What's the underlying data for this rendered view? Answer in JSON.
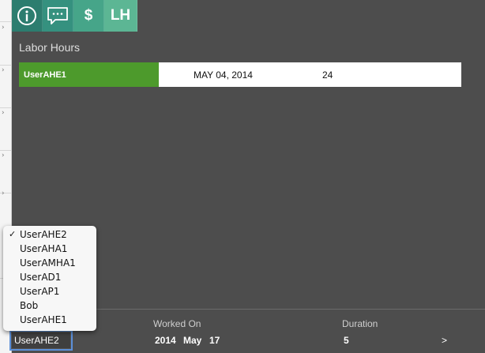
{
  "toolbar": {
    "buttons": [
      {
        "name": "info",
        "icon": "info-icon"
      },
      {
        "name": "comments",
        "icon": "chat-icon"
      },
      {
        "name": "cost",
        "label": "$"
      },
      {
        "name": "labor-hours",
        "label": "LH"
      }
    ]
  },
  "labor": {
    "title": "Labor Hours",
    "rows": [
      {
        "user": "UserAHE1",
        "date": "MAY 04, 2014",
        "duration": "24"
      }
    ]
  },
  "form": {
    "worked_on_label": "Worked On",
    "duration_label": "Duration",
    "year": "2014",
    "month": "May",
    "day": "17",
    "duration": "5",
    "next": ">",
    "selected_user": "UserAHE2"
  },
  "dropdown": {
    "check": "✓",
    "options": [
      "UserAHE2",
      "UserAHA1",
      "UserAMHA1",
      "UserAD1",
      "UserAP1",
      "Bob",
      "UserAHE1"
    ],
    "selected_index": 0
  },
  "colors": {
    "background": "#4d4d4d",
    "user_cell": "#4d9a2c",
    "toolbar": [
      "#2c7d6f",
      "#35917f",
      "#46a589",
      "#5cb694"
    ]
  }
}
